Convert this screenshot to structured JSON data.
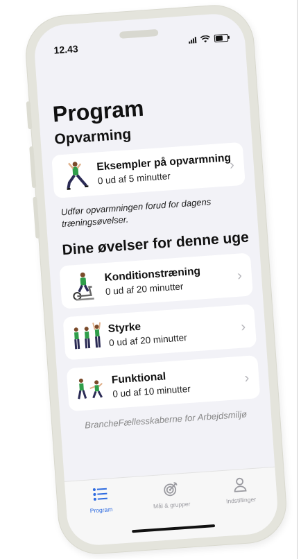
{
  "status": {
    "time": "12.43"
  },
  "page": {
    "title": "Program"
  },
  "warmup": {
    "section_title": "Opvarming",
    "card": {
      "name": "Eksempler på opvarmning",
      "progress": "0 ud af 5 minutter"
    },
    "description": "Udfør opvarmningen forud for dagens træningsøvelser."
  },
  "exercises": {
    "section_title": "Dine øvelser for denne uge",
    "items": [
      {
        "name": "Konditionstræning",
        "progress": "0 ud af 20 minutter"
      },
      {
        "name": "Styrke",
        "progress": "0 ud af 20 minutter"
      },
      {
        "name": "Funktional",
        "progress": "0 ud af 10 minutter"
      }
    ]
  },
  "footer": {
    "note": "BrancheFællesskaberne for Arbejdsmiljø"
  },
  "tabbar": {
    "items": [
      {
        "label": "Program",
        "icon": "list-icon",
        "active": true
      },
      {
        "label": "Mål & grupper",
        "icon": "target-icon",
        "active": false
      },
      {
        "label": "Indstillinger",
        "icon": "person-icon",
        "active": false
      }
    ]
  },
  "colors": {
    "accent": "#2e6be0",
    "shirt": "#2f9e4a",
    "background": "#f2f2f7"
  }
}
